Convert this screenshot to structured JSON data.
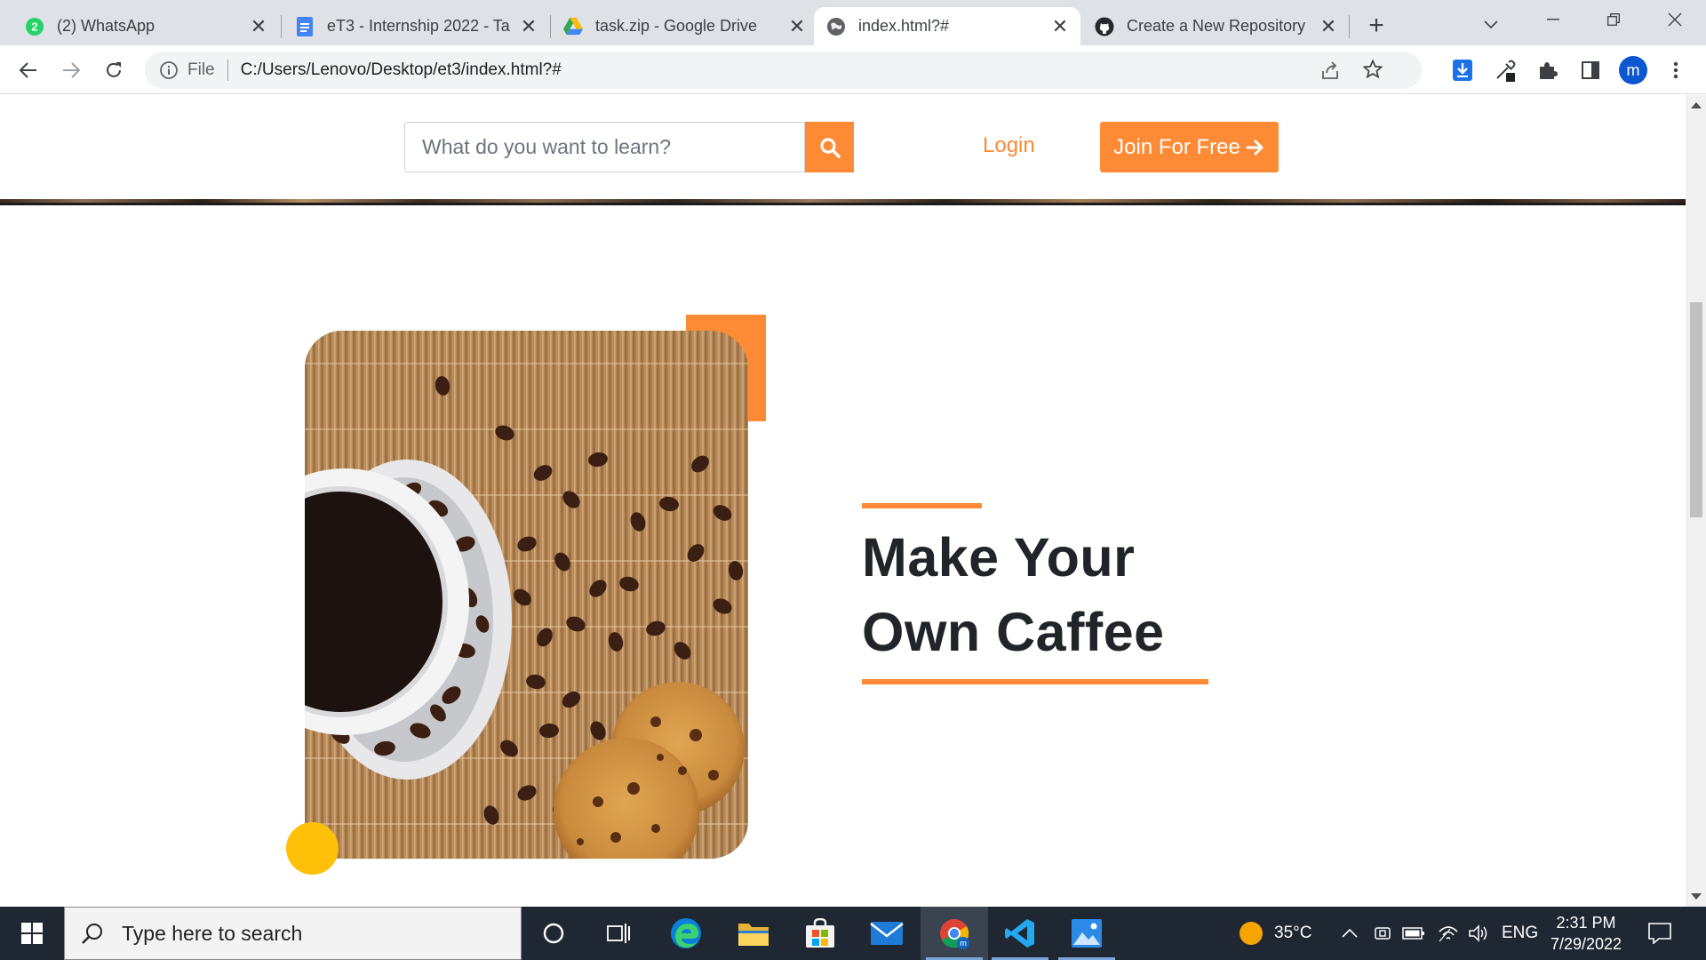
{
  "browser": {
    "tabs": [
      {
        "title": "(2) WhatsApp",
        "icon": "whatsapp-icon",
        "badge": "2"
      },
      {
        "title": "eT3 - Internship 2022 - Ta",
        "icon": "docs-icon"
      },
      {
        "title": "task.zip - Google Drive",
        "icon": "drive-icon"
      },
      {
        "title": "index.html?#",
        "icon": "globe-icon"
      },
      {
        "title": "Create a New Repository",
        "icon": "github-icon"
      }
    ],
    "scheme_label": "File",
    "url": "C:/Users/Lenovo/Desktop/et3/index.html?#",
    "profile_initial": "m"
  },
  "page": {
    "search_placeholder": "What do you want to learn?",
    "login_label": "Login",
    "join_label": "Join For Free",
    "headline_line1": "Make Your",
    "headline_line2": "Own Caffee"
  },
  "taskbar": {
    "search_placeholder": "Type here to search",
    "temperature": "35°C",
    "language": "ENG",
    "time": "2:31 PM",
    "date": "7/29/2022"
  },
  "colors": {
    "accent": "#fd8a35",
    "yellow": "#ffc107",
    "taskbar": "#1f2733"
  }
}
